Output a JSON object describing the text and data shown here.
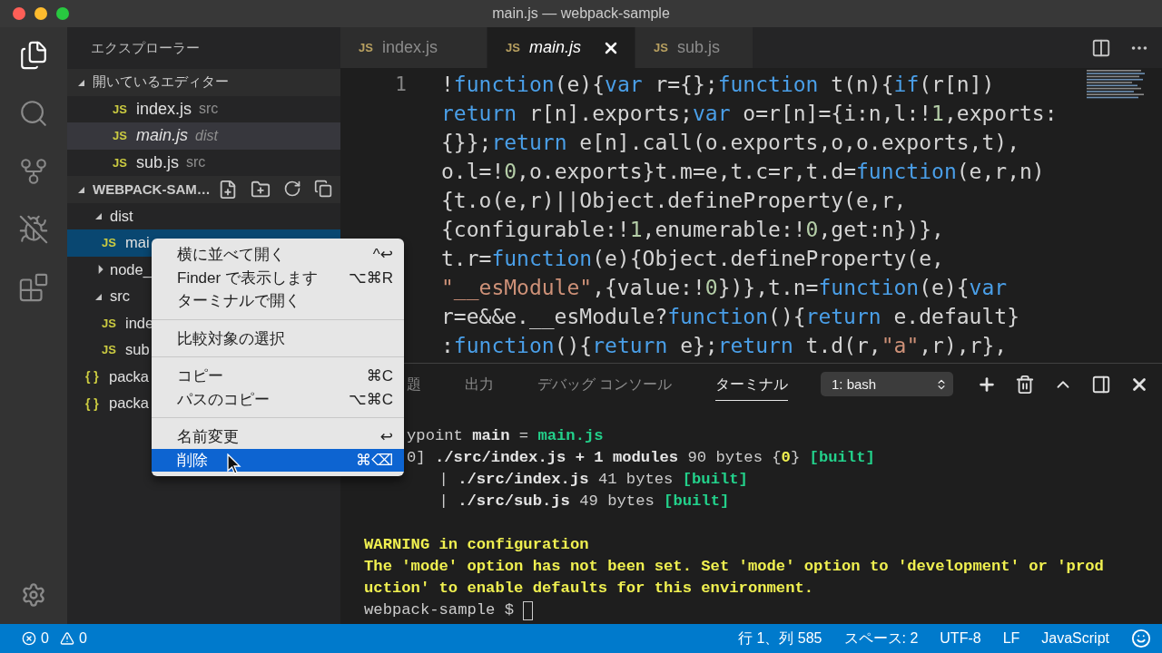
{
  "window": {
    "title": "main.js — webpack-sample"
  },
  "activity_bar": [
    {
      "kind": "files",
      "selected": true
    },
    {
      "kind": "search",
      "selected": false
    },
    {
      "kind": "scm",
      "selected": false
    },
    {
      "kind": "debug",
      "selected": false
    },
    {
      "kind": "extensions",
      "selected": false
    }
  ],
  "sidebar": {
    "title": "エクスプローラー",
    "open_editors": {
      "title": "開いているエディター",
      "expanded": true,
      "items": [
        {
          "name": "index.js",
          "folder": "src",
          "icon": "JS",
          "selected": false,
          "preview": false
        },
        {
          "name": "main.js",
          "folder": "dist",
          "icon": "JS",
          "selected": true,
          "preview": true
        },
        {
          "name": "sub.js",
          "folder": "src",
          "icon": "JS",
          "selected": false,
          "preview": false
        }
      ]
    },
    "project": {
      "title": "WEBPACK-SAM…",
      "expanded": true,
      "tree": [
        {
          "name": "dist",
          "kind": "folder",
          "expanded": true,
          "selected": false,
          "children": [
            {
              "name": "mai",
              "kind": "file",
              "icon": "JS",
              "selected": true
            }
          ]
        },
        {
          "name": "node_",
          "kind": "folder",
          "expanded": false,
          "selected": false
        },
        {
          "name": "src",
          "kind": "folder",
          "expanded": true,
          "selected": false,
          "children": [
            {
              "name": "inde",
              "kind": "file",
              "icon": "JS",
              "selected": false
            },
            {
              "name": "sub",
              "kind": "file",
              "icon": "JS",
              "selected": false
            }
          ]
        },
        {
          "name": "packa",
          "kind": "file",
          "icon": "{ }",
          "selected": false
        },
        {
          "name": "packa",
          "kind": "file",
          "icon": "{ }",
          "selected": false
        }
      ]
    }
  },
  "editor_tabs": [
    {
      "label": "index.js",
      "icon": "JS",
      "selected": false,
      "preview": false
    },
    {
      "label": "main.js",
      "icon": "JS",
      "selected": true,
      "preview": true
    },
    {
      "label": "sub.js",
      "icon": "JS",
      "selected": false,
      "preview": false
    }
  ],
  "editor": {
    "line_number": "1",
    "lines": [
      [
        {
          "kind": "plain",
          "text": "!"
        },
        {
          "kind": "keyword",
          "text": "function"
        },
        {
          "kind": "plain",
          "text": "(e){"
        },
        {
          "kind": "keyword",
          "text": "var"
        },
        {
          "kind": "plain",
          "text": " r={};"
        },
        {
          "kind": "keyword",
          "text": "function"
        },
        {
          "kind": "plain",
          "text": " t(n){"
        },
        {
          "kind": "keyword",
          "text": "if"
        },
        {
          "kind": "plain",
          "text": "(r[n])"
        }
      ],
      [
        {
          "kind": "keyword",
          "text": "return"
        },
        {
          "kind": "plain",
          "text": " r[n].exports;"
        },
        {
          "kind": "keyword",
          "text": "var"
        },
        {
          "kind": "plain",
          "text": " o=r[n]={i:n,l:!"
        },
        {
          "kind": "number",
          "text": "1"
        },
        {
          "kind": "plain",
          "text": ",exports:"
        }
      ],
      [
        {
          "kind": "plain",
          "text": "{}};"
        },
        {
          "kind": "keyword",
          "text": "return"
        },
        {
          "kind": "plain",
          "text": " e[n].call(o.exports,o,o.exports,t),"
        }
      ],
      [
        {
          "kind": "plain",
          "text": "o.l=!"
        },
        {
          "kind": "number",
          "text": "0"
        },
        {
          "kind": "plain",
          "text": ",o.exports}t.m=e,t.c=r,t.d="
        },
        {
          "kind": "keyword",
          "text": "function"
        },
        {
          "kind": "plain",
          "text": "(e,r,n)"
        }
      ],
      [
        {
          "kind": "plain",
          "text": "{t.o(e,r)||Object.defineProperty(e,r,"
        }
      ],
      [
        {
          "kind": "plain",
          "text": "{configurable:!"
        },
        {
          "kind": "number",
          "text": "1"
        },
        {
          "kind": "plain",
          "text": ",enumerable:!"
        },
        {
          "kind": "number",
          "text": "0"
        },
        {
          "kind": "plain",
          "text": ",get:n})},"
        }
      ],
      [
        {
          "kind": "plain",
          "text": "t.r="
        },
        {
          "kind": "keyword",
          "text": "function"
        },
        {
          "kind": "plain",
          "text": "(e){Object.defineProperty(e,"
        }
      ],
      [
        {
          "kind": "string",
          "text": "\"__esModule\""
        },
        {
          "kind": "plain",
          "text": ",{value:!"
        },
        {
          "kind": "number",
          "text": "0"
        },
        {
          "kind": "plain",
          "text": "})},t.n="
        },
        {
          "kind": "keyword",
          "text": "function"
        },
        {
          "kind": "plain",
          "text": "(e){"
        },
        {
          "kind": "keyword",
          "text": "var"
        }
      ],
      [
        {
          "kind": "plain",
          "text": "r=e&&e.__esModule?"
        },
        {
          "kind": "keyword",
          "text": "function"
        },
        {
          "kind": "plain",
          "text": "(){"
        },
        {
          "kind": "keyword",
          "text": "return"
        },
        {
          "kind": "plain",
          "text": " e.default}"
        }
      ],
      [
        {
          "kind": "plain",
          "text": ":"
        },
        {
          "kind": "keyword",
          "text": "function"
        },
        {
          "kind": "plain",
          "text": "(){"
        },
        {
          "kind": "keyword",
          "text": "return"
        },
        {
          "kind": "plain",
          "text": " e};"
        },
        {
          "kind": "keyword",
          "text": "return"
        },
        {
          "kind": "plain",
          "text": " t.d(r,"
        },
        {
          "kind": "string",
          "text": "\"a\""
        },
        {
          "kind": "plain",
          "text": ",r),r},"
        }
      ]
    ]
  },
  "panel": {
    "tabs": [
      {
        "label": "題",
        "selected": false
      },
      {
        "label": "出力",
        "selected": false
      },
      {
        "label": "デバッグ コンソール",
        "selected": false
      },
      {
        "label": "ターミナル",
        "selected": true
      }
    ],
    "terminal_select": "1: bash",
    "terminal": [
      {
        "kind": "partial",
        "tokens": [
          {
            "kind": "plain",
            "text": "ypoint "
          },
          {
            "kind": "bold",
            "text": "main"
          },
          {
            "kind": "plain",
            "text": " = "
          },
          {
            "kind": "green",
            "text": "main.js"
          }
        ]
      },
      {
        "kind": "partial",
        "tokens": [
          {
            "kind": "plain",
            "text": "0] "
          },
          {
            "kind": "bold",
            "text": "./src/index.js + 1 modules"
          },
          {
            "kind": "plain",
            "text": " 90 bytes {"
          },
          {
            "kind": "yellow",
            "text": "0"
          },
          {
            "kind": "plain",
            "text": "} "
          },
          {
            "kind": "green",
            "text": "[built]"
          }
        ]
      },
      {
        "kind": "full",
        "tokens": [
          {
            "kind": "plain",
            "text": "        | "
          },
          {
            "kind": "bold",
            "text": "./src/index.js"
          },
          {
            "kind": "plain",
            "text": " 41 bytes "
          },
          {
            "kind": "green",
            "text": "[built]"
          }
        ]
      },
      {
        "kind": "full",
        "tokens": [
          {
            "kind": "plain",
            "text": "        | "
          },
          {
            "kind": "bold",
            "text": "./src/sub.js"
          },
          {
            "kind": "plain",
            "text": " 49 bytes "
          },
          {
            "kind": "green",
            "text": "[built]"
          }
        ]
      },
      {
        "kind": "blank"
      },
      {
        "kind": "full",
        "tokens": [
          {
            "kind": "yellow",
            "text": "WARNING in configuration"
          }
        ]
      },
      {
        "kind": "full",
        "tokens": [
          {
            "kind": "yellow",
            "text": "The 'mode' option has not been set. Set 'mode' option to 'development' or 'prod"
          }
        ]
      },
      {
        "kind": "full",
        "tokens": [
          {
            "kind": "yellow",
            "text": "uction' to enable defaults for this environment."
          }
        ]
      },
      {
        "kind": "prompt",
        "tokens": [
          {
            "kind": "plain",
            "text": "webpack-sample $ "
          }
        ]
      }
    ]
  },
  "context_menu": [
    [
      {
        "label": "横に並べて開く",
        "shortcut": "^↩",
        "selected": false
      },
      {
        "label": "Finder で表示します",
        "shortcut": "⌥⌘R",
        "selected": false
      },
      {
        "label": "ターミナルで開く",
        "selected": false
      }
    ],
    [
      {
        "label": "比較対象の選択",
        "selected": false
      }
    ],
    [
      {
        "label": "コピー",
        "shortcut": "⌘C",
        "selected": false
      },
      {
        "label": "パスのコピー",
        "shortcut": "⌥⌘C",
        "selected": false
      }
    ],
    [
      {
        "label": "名前変更",
        "shortcut": "↩",
        "selected": false
      },
      {
        "label": "削除",
        "shortcut": "⌘⌫",
        "selected": true
      }
    ]
  ],
  "status_bar": {
    "errors": "0",
    "warnings": "0",
    "items": [
      "行 1、列 585",
      "スペース: 2",
      "UTF-8",
      "LF",
      "JavaScript"
    ]
  }
}
